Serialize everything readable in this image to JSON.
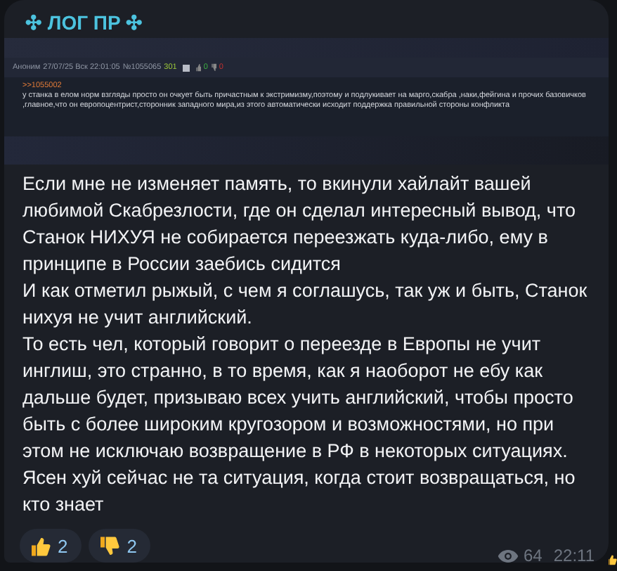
{
  "channel": {
    "title": "✣ ЛОГ ПР ✣"
  },
  "embedded_post": {
    "author": "Аноним",
    "datetime": "27/07/25 Вск 22:01:05",
    "post_number": "№1055065",
    "post_count": "301",
    "likes": "0",
    "dislikes": "0",
    "reply_link": ">>1055002",
    "text": "у станка в елом норм взгляды просто он очкует быть причастным к экстримизму,поэтому и подлукивает на марго,скабра ,наки,фейгина и прочих базовичков ,главное,что он европоцентрист,сторонник западного мира,из этого автоматически исходит поддержка правильной стороны конфликта"
  },
  "message": {
    "paragraphs": [
      "Если мне не изменяет память, то вкинули хайлайт вашей любимой Скабрезлости, где он сделал интересный вывод, что Станок НИХУЯ не собирается переезжать куда-либо, ему в принципе в России заебись сидится",
      "И как отметил рыжый, с чем я соглашусь, так уж и быть, Станок нихуя не учит английский.",
      "То есть чел, который говорит о переезде в Европы не учит инглиш, это странно, в то время, как я наоборот не ебу как дальше будет, призываю всех учить английский, чтобы просто быть с более широким кругозором и возможностями, но при этом не  исключаю возвращение в РФ в некоторых ситуациях. Ясен хуй сейчас не та ситуация, когда стоит возвращаться, но кто знает"
    ]
  },
  "reactions": [
    {
      "kind": "thumbs_up",
      "count": "2"
    },
    {
      "kind": "thumbs_down",
      "count": "2"
    }
  ],
  "views": "64",
  "time": "22:11"
}
